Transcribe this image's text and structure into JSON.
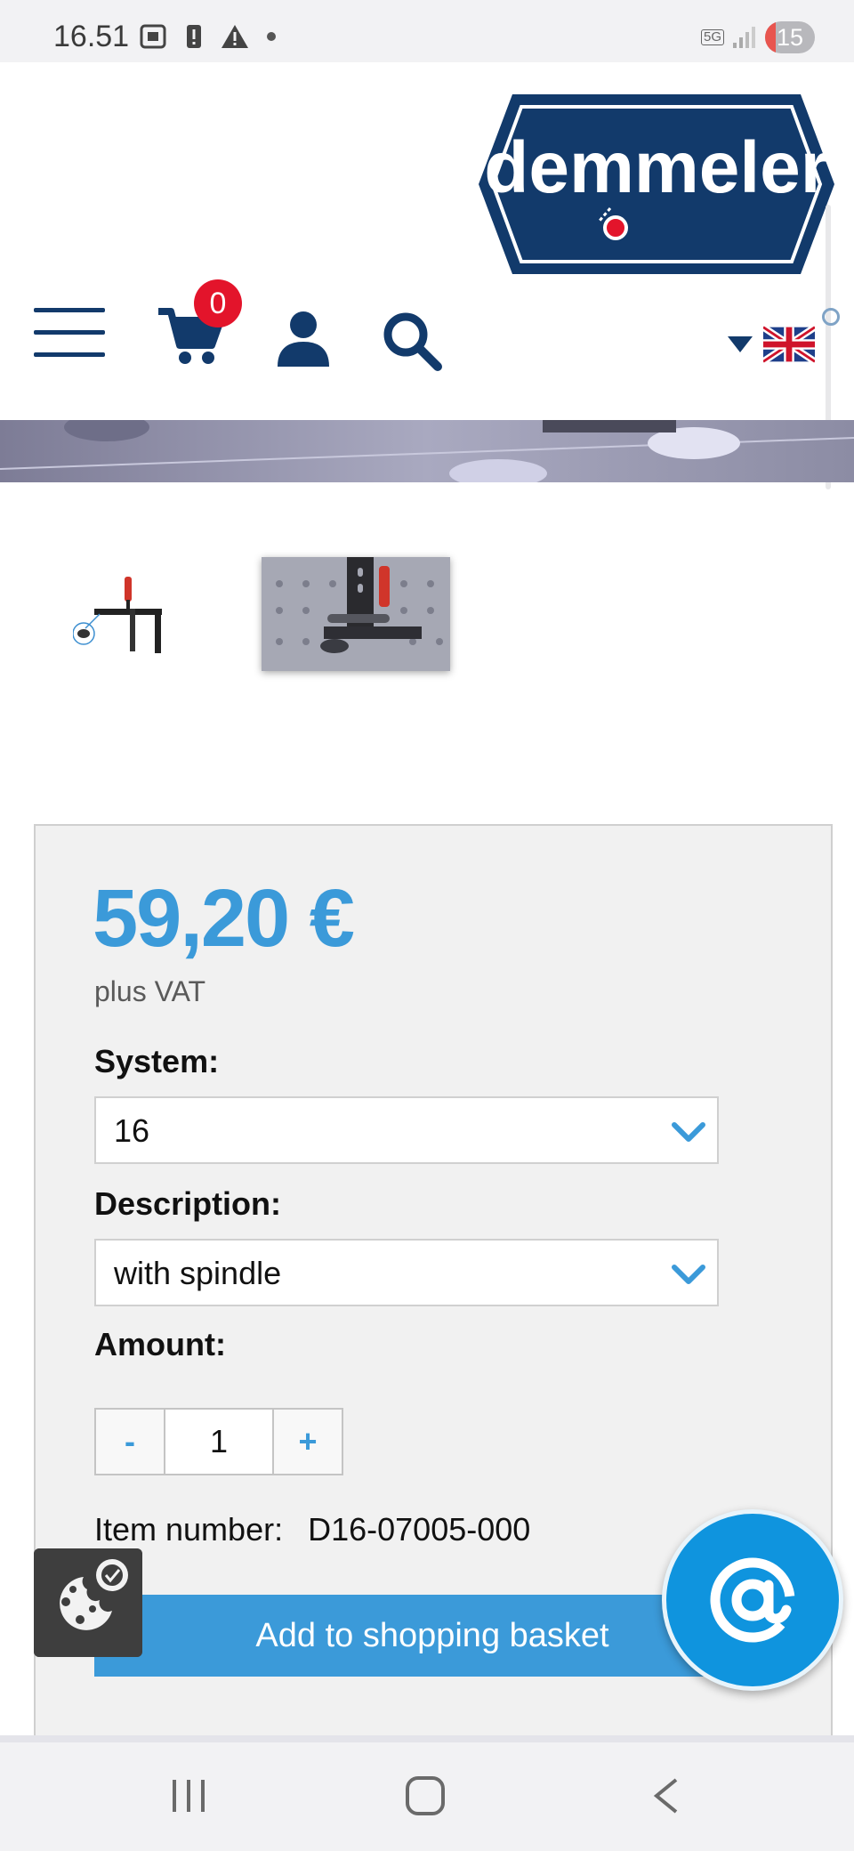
{
  "status_bar": {
    "time": "16.51",
    "network": "5G",
    "battery": "15"
  },
  "header": {
    "logo_text": "demmeler",
    "cart_count": "0",
    "language": "English",
    "icons": [
      "menu-icon",
      "cart-icon",
      "user-icon",
      "search-icon",
      "caret-down-icon",
      "uk-flag-icon"
    ]
  },
  "product": {
    "price": "59,20 €",
    "vat_note": "plus VAT",
    "system_label": "System:",
    "system_value": "16",
    "description_label": "Description:",
    "description_value": "with spindle",
    "amount_label": "Amount:",
    "qty_minus": "-",
    "qty_value": "1",
    "qty_plus": "+",
    "item_number_label": "Item number:",
    "item_number_value": "D16-07005-000",
    "add_button": "Add to shopping basket"
  },
  "floating": {
    "contact_symbol": "@",
    "cookie_icon": "cookie-settings-icon"
  },
  "colors": {
    "brand_navy": "#123a6b",
    "accent_blue": "#3b9ad9",
    "badge_red": "#e3142b"
  }
}
